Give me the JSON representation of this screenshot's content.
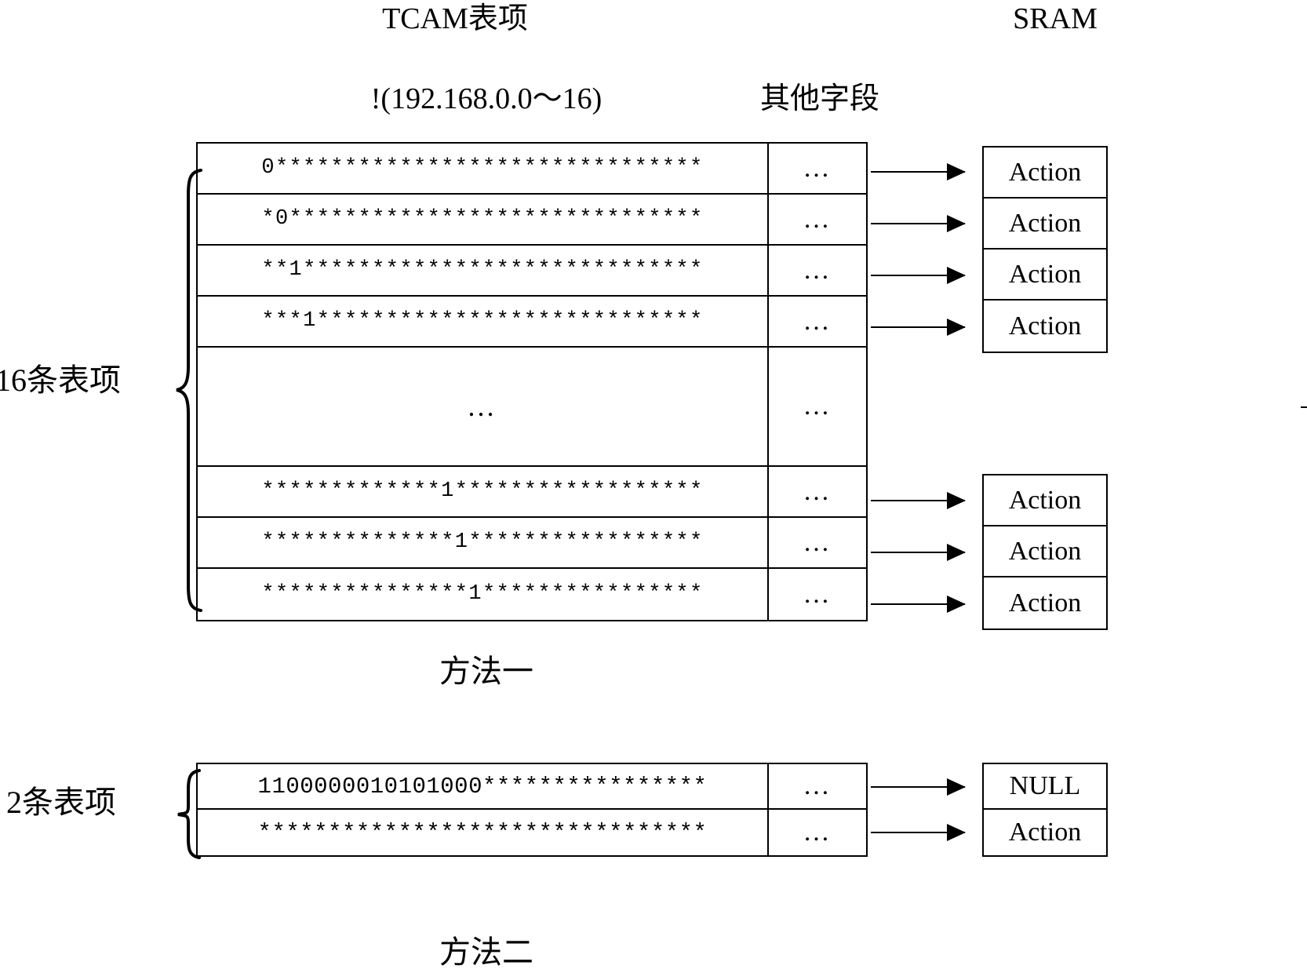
{
  "headers": {
    "tcam_title": "TCAM表项",
    "sram_title": "SRAM",
    "prefix_field": "!(192.168.0.0～16)",
    "other_field": "其他字段"
  },
  "side_labels": {
    "method_one_count": "16条表项",
    "method_two_count": "2条表项"
  },
  "captions": {
    "method_one": "方法一",
    "method_two": "方法二"
  },
  "method_one": {
    "other_field_cell": "…",
    "rows": [
      {
        "mask": "0*******************************",
        "other": "…",
        "sram": "Action"
      },
      {
        "mask": "*0******************************",
        "other": "…",
        "sram": "Action"
      },
      {
        "mask": "**1*****************************",
        "other": "…",
        "sram": "Action"
      },
      {
        "mask": "***1****************************",
        "other": "…",
        "sram": "Action"
      },
      {
        "mask": "…",
        "other": "…",
        "sram": ""
      },
      {
        "mask": "*************1******************",
        "other": "…",
        "sram": "Action"
      },
      {
        "mask": "**************1*****************",
        "other": "…",
        "sram": "Action"
      },
      {
        "mask": "***************1****************",
        "other": "…",
        "sram": "Action"
      }
    ]
  },
  "method_two": {
    "rows": [
      {
        "mask": "1100000010101000****************",
        "other": "…",
        "sram": "NULL"
      },
      {
        "mask": "********************************",
        "other": "…",
        "sram": "Action"
      }
    ]
  }
}
